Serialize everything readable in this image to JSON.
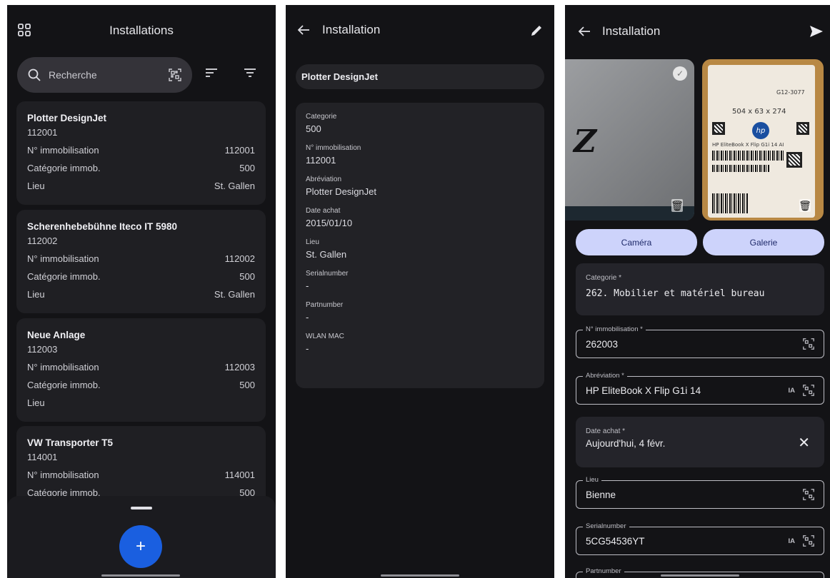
{
  "list_screen": {
    "title": "Installations",
    "search_placeholder": "Recherche",
    "cards": [
      {
        "name": "Plotter DesignJet",
        "id": "112001",
        "rows": [
          {
            "label": "N° immobilisation",
            "value": "112001"
          },
          {
            "label": "Catégorie immob.",
            "value": "500"
          },
          {
            "label": "Lieu",
            "value": "St. Gallen"
          }
        ]
      },
      {
        "name": "Scherenhebebühne Iteco IT 5980",
        "id": "112002",
        "rows": [
          {
            "label": "N° immobilisation",
            "value": "112002"
          },
          {
            "label": "Catégorie immob.",
            "value": "500"
          },
          {
            "label": "Lieu",
            "value": "St. Gallen"
          }
        ]
      },
      {
        "name": "Neue Anlage",
        "id": "112003",
        "rows": [
          {
            "label": "N° immobilisation",
            "value": "112003"
          },
          {
            "label": "Catégorie immob.",
            "value": "500"
          },
          {
            "label": "Lieu",
            "value": ""
          }
        ]
      },
      {
        "name": "VW Transporter T5",
        "id": "114001",
        "rows": [
          {
            "label": "N° immobilisation",
            "value": "114001"
          },
          {
            "label": "Catégorie immob.",
            "value": "500"
          }
        ]
      }
    ],
    "fab_label": "+"
  },
  "detail_screen": {
    "title": "Installation",
    "name": "Plotter DesignJet",
    "fields": [
      {
        "label": "Categorie",
        "value": "500"
      },
      {
        "label": "N° immobilisation",
        "value": "112001"
      },
      {
        "label": "Abréviation",
        "value": "Plotter DesignJet"
      },
      {
        "label": "Date achat",
        "value": "2015/01/10"
      },
      {
        "label": "Lieu",
        "value": "St. Gallen"
      },
      {
        "label": "Serialnumber",
        "value": "-"
      },
      {
        "label": "Partnumber",
        "value": "-"
      },
      {
        "label": "WLAN MAC",
        "value": "-"
      }
    ]
  },
  "edit_screen": {
    "title": "Installation",
    "camera_button": "Caméra",
    "gallery_button": "Galerie",
    "photo_text": {
      "code": "G12-3077",
      "dims": "504 x 63 x 274",
      "model": "HP EliteBook X Flip G1i 14 AI"
    },
    "categorie": {
      "label": "Categorie *",
      "value": "262.  Mobilier et matériel bureau"
    },
    "immobilisation": {
      "label": "N° immobilisation *",
      "value": "262003"
    },
    "abreviation": {
      "label": "Abréviation *",
      "value": "HP EliteBook X Flip G1i 14",
      "ia": "IA"
    },
    "date_achat": {
      "label": "Date achat *",
      "value": "Aujourd'hui, 4 févr."
    },
    "lieu": {
      "label": "Lieu",
      "value": "Bienne"
    },
    "serialnumber": {
      "label": "Serialnumber",
      "value": "5CG54536YT",
      "ia": "IA"
    },
    "partnumber": {
      "label": "Partnumber"
    }
  },
  "colors": {
    "background": "#131316",
    "card": "#1f1f23",
    "fab": "#1a5fe0",
    "pill_button": "#cdd3fb"
  }
}
